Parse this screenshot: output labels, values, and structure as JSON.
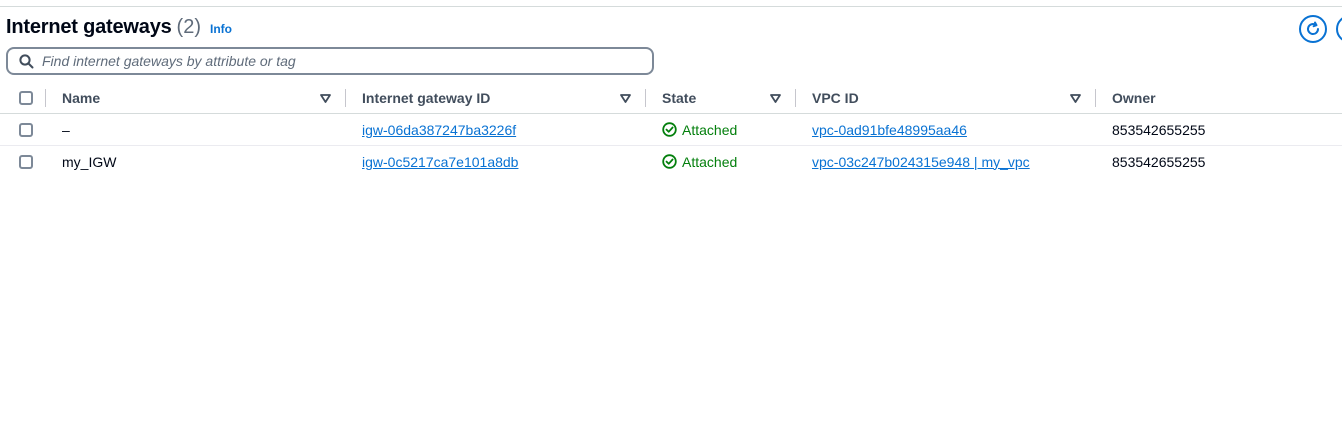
{
  "header": {
    "title": "Internet gateways",
    "count": "(2)",
    "info": "Info"
  },
  "icons": {
    "refresh": "refresh-icon",
    "search": "search-icon",
    "sort": "sort-triangle-down-icon",
    "status": "check-circle-icon"
  },
  "colors": {
    "link": "#0972d3",
    "success": "#037f0c",
    "text": "#000716",
    "header_text": "#414d5c"
  },
  "search": {
    "placeholder": "Find internet gateways by attribute or tag",
    "value": ""
  },
  "table": {
    "columns": [
      "Name",
      "Internet gateway ID",
      "State",
      "VPC ID",
      "Owner"
    ],
    "rows": [
      {
        "name": "–",
        "igw_id": "igw-06da387247ba3226f",
        "state": "Attached",
        "vpc_id": "vpc-0ad91bfe48995aa46",
        "owner": "853542655255"
      },
      {
        "name": "my_IGW",
        "igw_id": "igw-0c5217ca7e101a8db",
        "state": "Attached",
        "vpc_id": "vpc-03c247b024315e948 | my_vpc",
        "owner": "853542655255"
      }
    ]
  }
}
